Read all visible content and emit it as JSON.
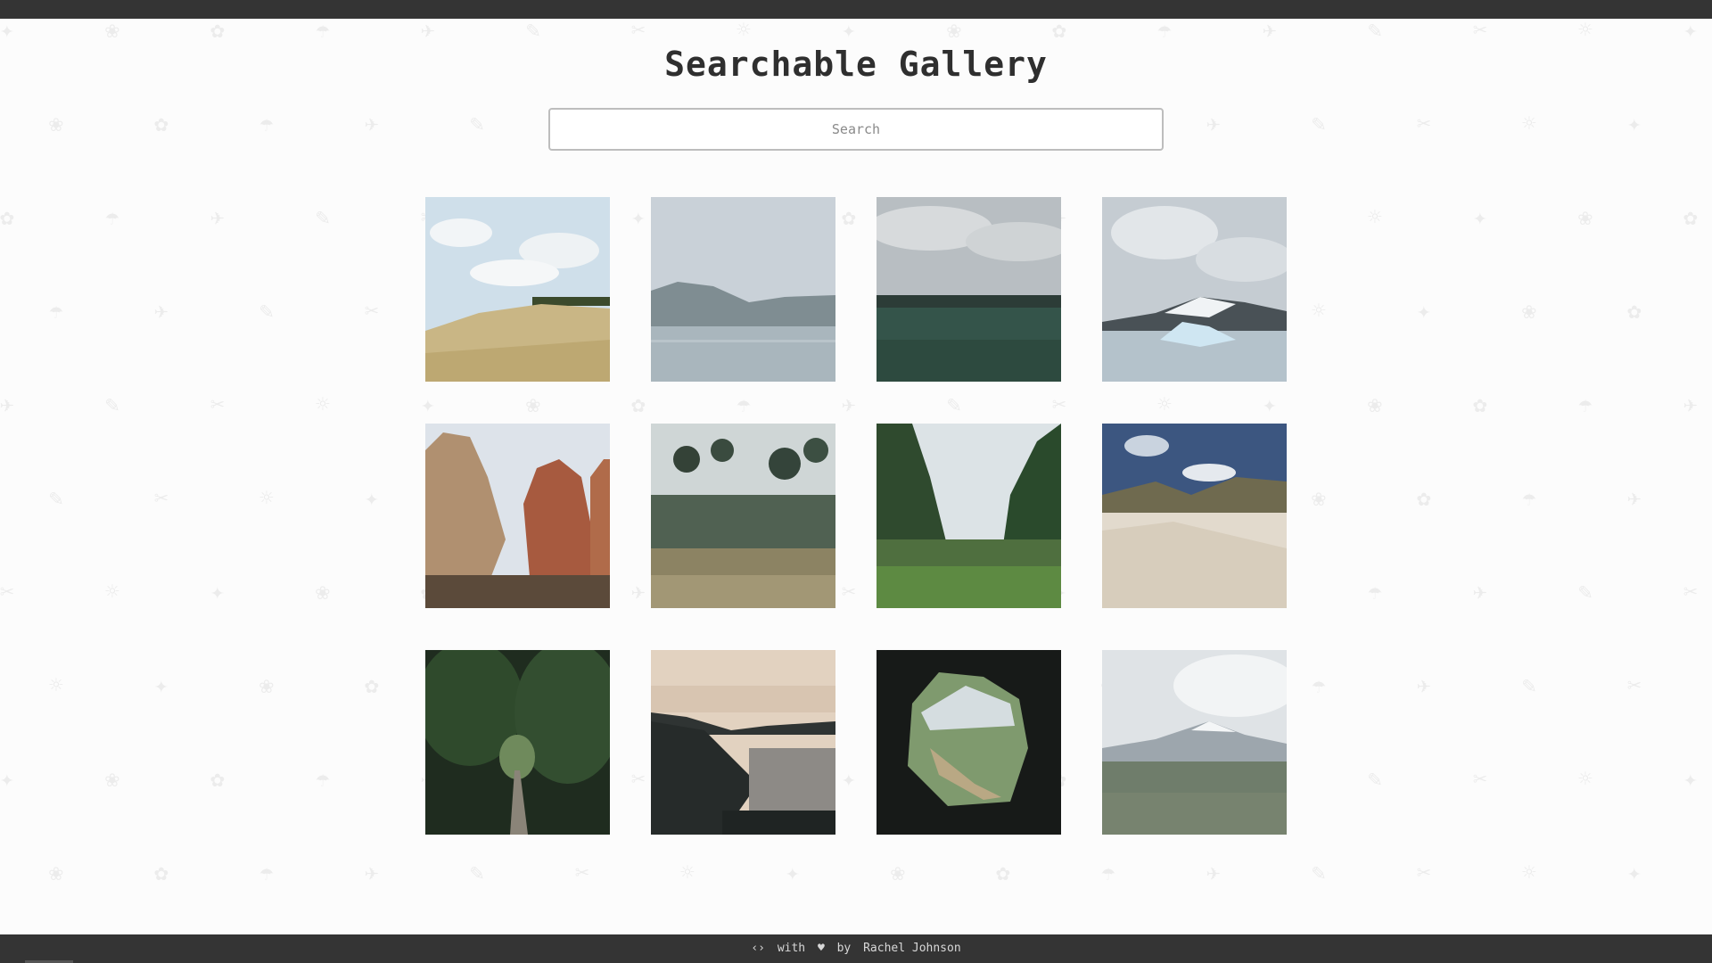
{
  "page": {
    "title": "Searchable Gallery"
  },
  "search": {
    "placeholder": "Search",
    "value": ""
  },
  "gallery": {
    "images": [
      {
        "alt": "hill-field-clouds"
      },
      {
        "alt": "lake-mountains"
      },
      {
        "alt": "green-meadow-cloudy"
      },
      {
        "alt": "icebergs-lagoon"
      },
      {
        "alt": "red-canyon-cliffs"
      },
      {
        "alt": "shrub-garden"
      },
      {
        "alt": "forest-valley-stream"
      },
      {
        "alt": "sand-dunes"
      },
      {
        "alt": "tree-tunnel-path"
      },
      {
        "alt": "coastal-cliff-sunset"
      },
      {
        "alt": "cave-opening-valley"
      },
      {
        "alt": "snowy-mountain-field"
      }
    ]
  },
  "footer": {
    "code_symbol": "‹›",
    "with": "with",
    "heart": "♥",
    "by": "by",
    "author": "Rachel Johnson"
  },
  "colors": {
    "bars": "#343434",
    "background": "#fcfcfc"
  }
}
